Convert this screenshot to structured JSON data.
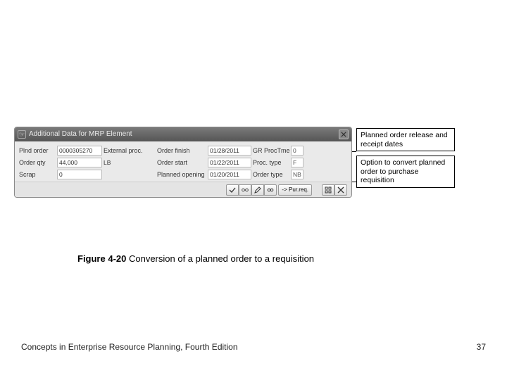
{
  "panel": {
    "title": "Additional Data for MRP Element",
    "toolbar": {
      "pur_req_label": "-> Pur.req."
    }
  },
  "fields": {
    "plnd_order_label": "Plnd order",
    "plnd_order_value": "0000305270",
    "plnd_order_type": "External proc.",
    "order_qty_label": "Order qty",
    "order_qty_value": "44,000",
    "order_qty_unit": "LB",
    "scrap_label": "Scrap",
    "scrap_value": "0",
    "order_finish_label": "Order finish",
    "order_finish_value": "01/28/2011",
    "order_start_label": "Order start",
    "order_start_value": "01/22/2011",
    "planned_opening_label": "Planned opening",
    "planned_opening_value": "01/20/2011",
    "gr_proc_time_label": "GR ProcTme",
    "gr_proc_time_value": "0",
    "proc_type_label": "Proc. type",
    "proc_type_value": "F",
    "order_type_label": "Order type",
    "order_type_value": "NB"
  },
  "callouts": {
    "c1": "Planned order release and receipt dates",
    "c2": "Option to convert planned order to purchase requisition"
  },
  "caption": {
    "figno": "Figure 4-20",
    "text": "  Conversion of a planned order to a requisition"
  },
  "footer": {
    "book": "Concepts in Enterprise Resource Planning, Fourth Edition",
    "page": "37"
  }
}
